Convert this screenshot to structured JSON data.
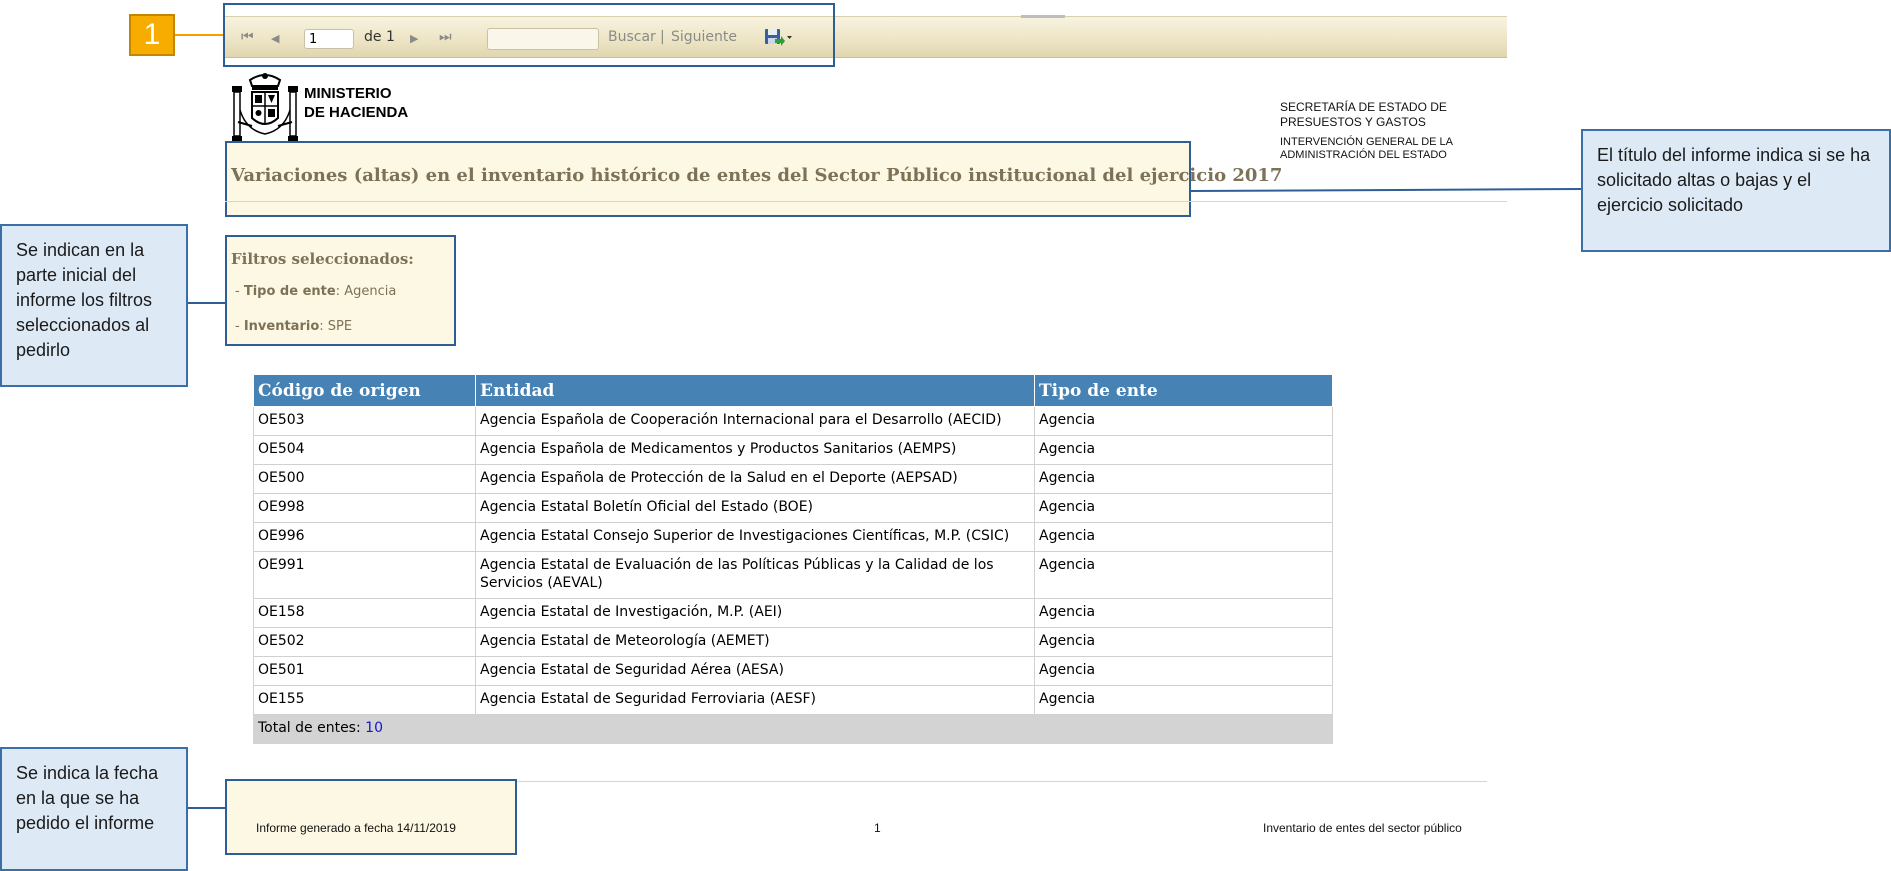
{
  "badge": {
    "number": "1"
  },
  "toolbar": {
    "first_icon": "⏮",
    "prev_icon": "◀",
    "page_value": "1",
    "of_label": "de 1",
    "next_icon": "▶",
    "last_icon": "⏭",
    "search_label": "Buscar",
    "separator": "|",
    "next_label": "Siguiente"
  },
  "header": {
    "ministry_line1": "MINISTERIO",
    "ministry_line2": "DE HACIENDA",
    "secretaria_line1": "SECRETARÍA DE ESTADO DE",
    "secretaria_line2": "PRESUESTOS Y GASTOS",
    "intervencion_line1": "INTERVENCIÓN GENERAL DE LA",
    "intervencion_line2": "ADMINISTRACIÓN DEL ESTADO"
  },
  "report": {
    "title": "Variaciones (altas) en el inventario histórico de entes del Sector Público institucional del ejercicio 2017"
  },
  "filters": {
    "heading": "Filtros seleccionados:",
    "items": [
      {
        "label": "Tipo de ente",
        "value": "Agencia"
      },
      {
        "label": "Inventario",
        "value": "SPE"
      }
    ]
  },
  "table": {
    "columns": [
      "Código  de origen",
      "Entidad",
      "Tipo de ente"
    ],
    "rows": [
      [
        "OE503",
        "Agencia Española de Cooperación Internacional para el Desarrollo (AECID)",
        "Agencia"
      ],
      [
        "OE504",
        "Agencia Española de Medicamentos y Productos Sanitarios (AEMPS)",
        "Agencia"
      ],
      [
        "OE500",
        "Agencia Española de Protección de la Salud en el Deporte (AEPSAD)",
        "Agencia"
      ],
      [
        "OE998",
        "Agencia Estatal Boletín Oficial del Estado (BOE)",
        "Agencia"
      ],
      [
        "OE996",
        "Agencia Estatal Consejo Superior de Investigaciones Científicas, M.P. (CSIC)",
        "Agencia"
      ],
      [
        "OE991",
        "Agencia Estatal de Evaluación de las Políticas Públicas y la Calidad de los Servicios (AEVAL)",
        "Agencia"
      ],
      [
        "OE158",
        "Agencia Estatal de Investigación, M.P. (AEI)",
        "Agencia"
      ],
      [
        "OE502",
        "Agencia Estatal de Meteorología (AEMET)",
        "Agencia"
      ],
      [
        "OE501",
        "Agencia Estatal de Seguridad Aérea (AESA)",
        "Agencia"
      ],
      [
        "OE155",
        "Agencia Estatal de Seguridad Ferroviaria (AESF)",
        "Agencia"
      ]
    ],
    "total_label": "Total de entes:",
    "total_value": "10"
  },
  "footer": {
    "generated": "Informe generado a fecha 14/11/2019",
    "page": "1",
    "app_name": "Inventario de entes del sector público"
  },
  "callouts": {
    "title_note": "El título del informe indica si se ha solicitado altas o bajas y el ejercicio solicitado",
    "filters_note": "Se indican en la parte inicial del informe los filtros seleccionados al pedirlo",
    "date_note": "Se indica la fecha en la que se ha pedido el informe"
  },
  "colors": {
    "header_blue": "#4682b4",
    "callout_bg": "#dde9f5",
    "callout_border": "#3a6fa8",
    "badge_orange": "#f6ad00",
    "report_text": "#7d7256"
  }
}
